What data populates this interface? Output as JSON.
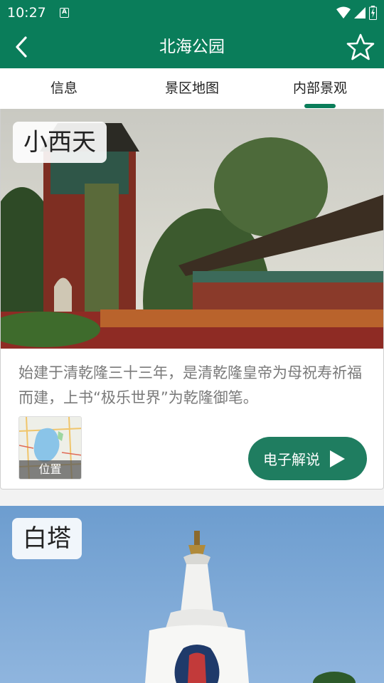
{
  "status_bar": {
    "time": "10:27",
    "notification_icon": "A"
  },
  "app_bar": {
    "title": "北海公园",
    "back_icon": "chevron-left-icon",
    "favorite_icon": "star-outline-icon"
  },
  "tabs": [
    {
      "label": "信息",
      "active": false
    },
    {
      "label": "景区地图",
      "active": false
    },
    {
      "label": "内部景观",
      "active": true
    }
  ],
  "colors": {
    "primary": "#0a7d5a",
    "button": "#1f7d60",
    "description_text": "#7a7a7a"
  },
  "attractions": [
    {
      "name": "小西天",
      "description": "始建于清乾隆三十三年，是清乾隆皇帝为母祝寿祈福而建，上书“极乐世界”为乾隆御笔。",
      "location_label": "位置",
      "audio_button_label": "电子解说"
    },
    {
      "name": "白塔"
    }
  ]
}
